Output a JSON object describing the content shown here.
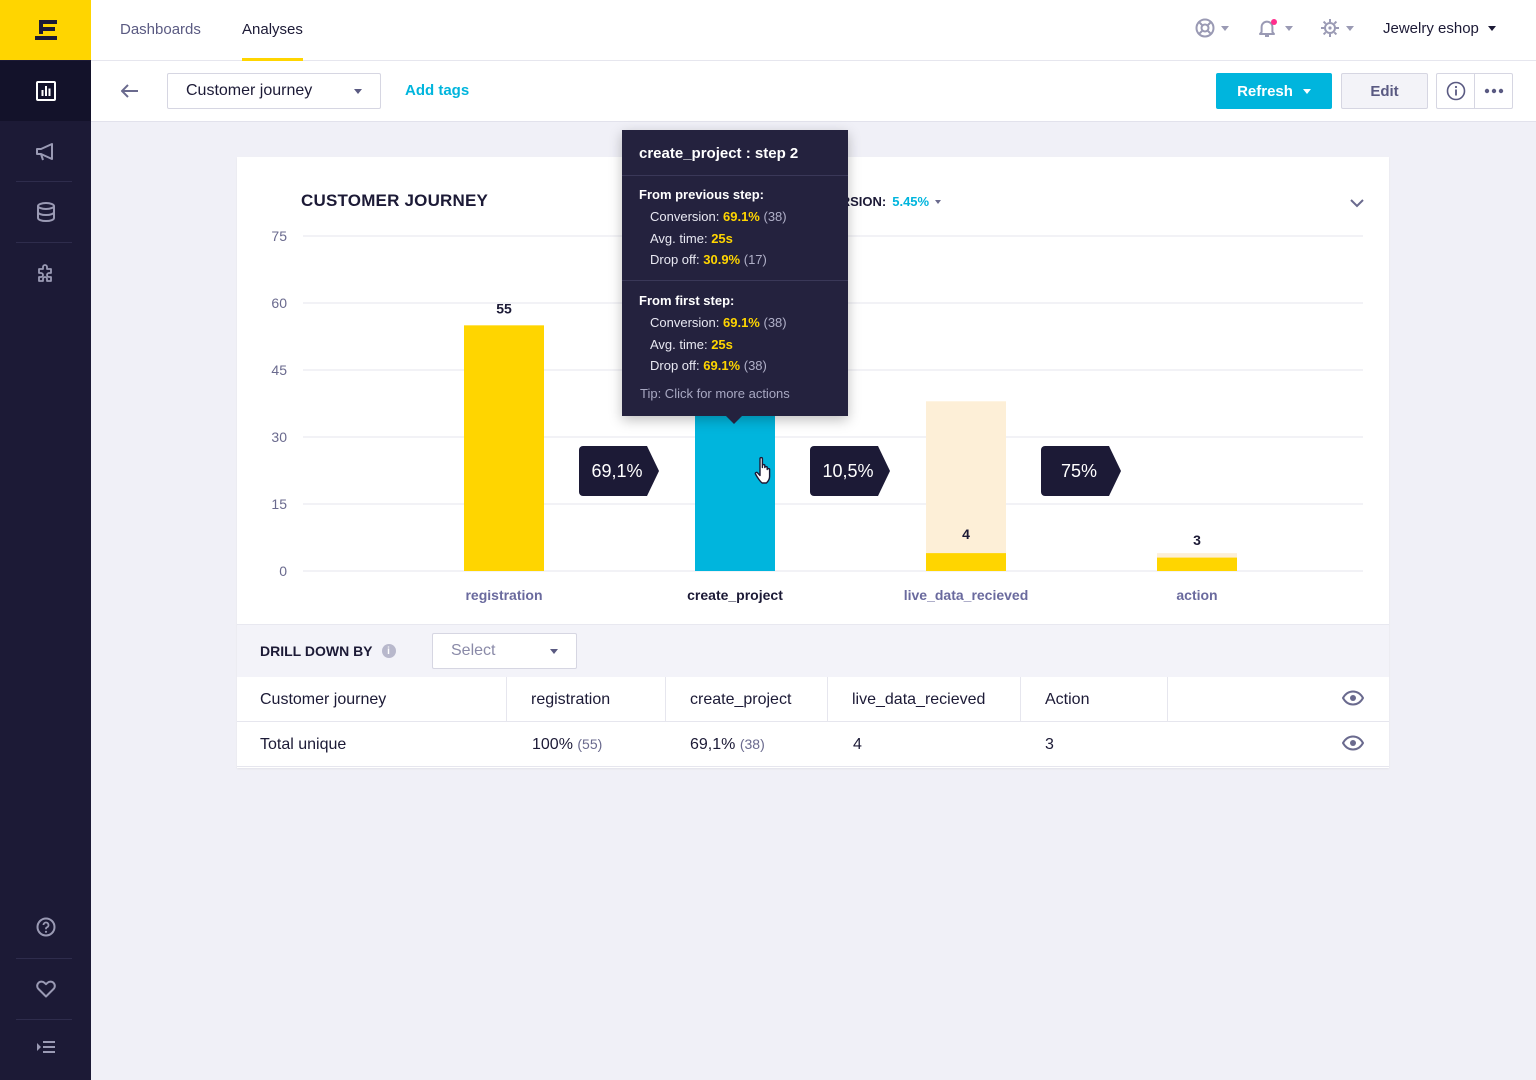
{
  "colors": {
    "brand_yellow": "#ffd500",
    "sidebar": "#1c1a36",
    "accent_blue": "#00b5dd",
    "bar_light": "#fdefd7"
  },
  "sidebar": {
    "items": [
      {
        "icon": "bar-chart-icon",
        "active": true
      },
      {
        "icon": "megaphone-icon",
        "active": false
      },
      {
        "icon": "database-icon",
        "active": false
      },
      {
        "icon": "puzzle-icon",
        "active": false
      }
    ],
    "bottom_items": [
      {
        "icon": "help-icon"
      },
      {
        "icon": "heart-icon"
      },
      {
        "icon": "collapse-menu-icon"
      }
    ]
  },
  "topbar": {
    "tabs": [
      {
        "label": "Dashboards",
        "active": false
      },
      {
        "label": "Analyses",
        "active": true
      }
    ],
    "project": "Jewelry eshop"
  },
  "subbar": {
    "analysis_name": "Customer journey",
    "add_tags": "Add tags",
    "refresh": "Refresh",
    "edit": "Edit"
  },
  "card": {
    "title": "CUSTOMER JOURNEY",
    "total_conversion_label": "TOTAL CONVERSION:",
    "total_conversion_value": "5.45%"
  },
  "chart_data": {
    "type": "bar",
    "title": "CUSTOMER JOURNEY",
    "categories": [
      "registration",
      "create_project",
      "live_data_recieved",
      "action"
    ],
    "values": [
      55,
      38,
      4,
      3
    ],
    "previous_step_values": [
      null,
      55,
      38,
      4
    ],
    "value_labels": [
      "55",
      "",
      "4",
      "3"
    ],
    "step_conversions": [
      "69,1%",
      "10,5%",
      "75%"
    ],
    "yticks": [
      0,
      15,
      30,
      45,
      60,
      75
    ],
    "ylim": [
      0,
      75
    ],
    "highlighted_category": "create_project",
    "grid": true
  },
  "tooltip": {
    "title": "create_project : step 2",
    "prev_header": "From previous step:",
    "prev": {
      "conversion_label": "Conversion:",
      "conversion": "69.1%",
      "conversion_count": "(38)",
      "time_label": "Avg. time:",
      "time": "25s",
      "drop_label": "Drop off:",
      "drop": "30.9%",
      "drop_count": "(17)"
    },
    "first_header": "From first step:",
    "first": {
      "conversion_label": "Conversion:",
      "conversion": "69.1%",
      "conversion_count": "(38)",
      "time_label": "Avg. time:",
      "time": "25s",
      "drop_label": "Drop off:",
      "drop": "69.1%",
      "drop_count": "(38)"
    },
    "tip": "Tip: Click for more actions"
  },
  "drill": {
    "label": "DRILL DOWN BY",
    "select_placeholder": "Select"
  },
  "table": {
    "headers": [
      "Customer journey",
      "registration",
      "create_project",
      "live_data_recieved",
      "Action"
    ],
    "rows": [
      {
        "name": "Total unique",
        "cells": [
          {
            "value": "100%",
            "count": "(55)"
          },
          {
            "value": "69,1%",
            "count": "(38)"
          },
          {
            "value": "4",
            "count": ""
          },
          {
            "value": "3",
            "count": ""
          }
        ]
      }
    ]
  }
}
